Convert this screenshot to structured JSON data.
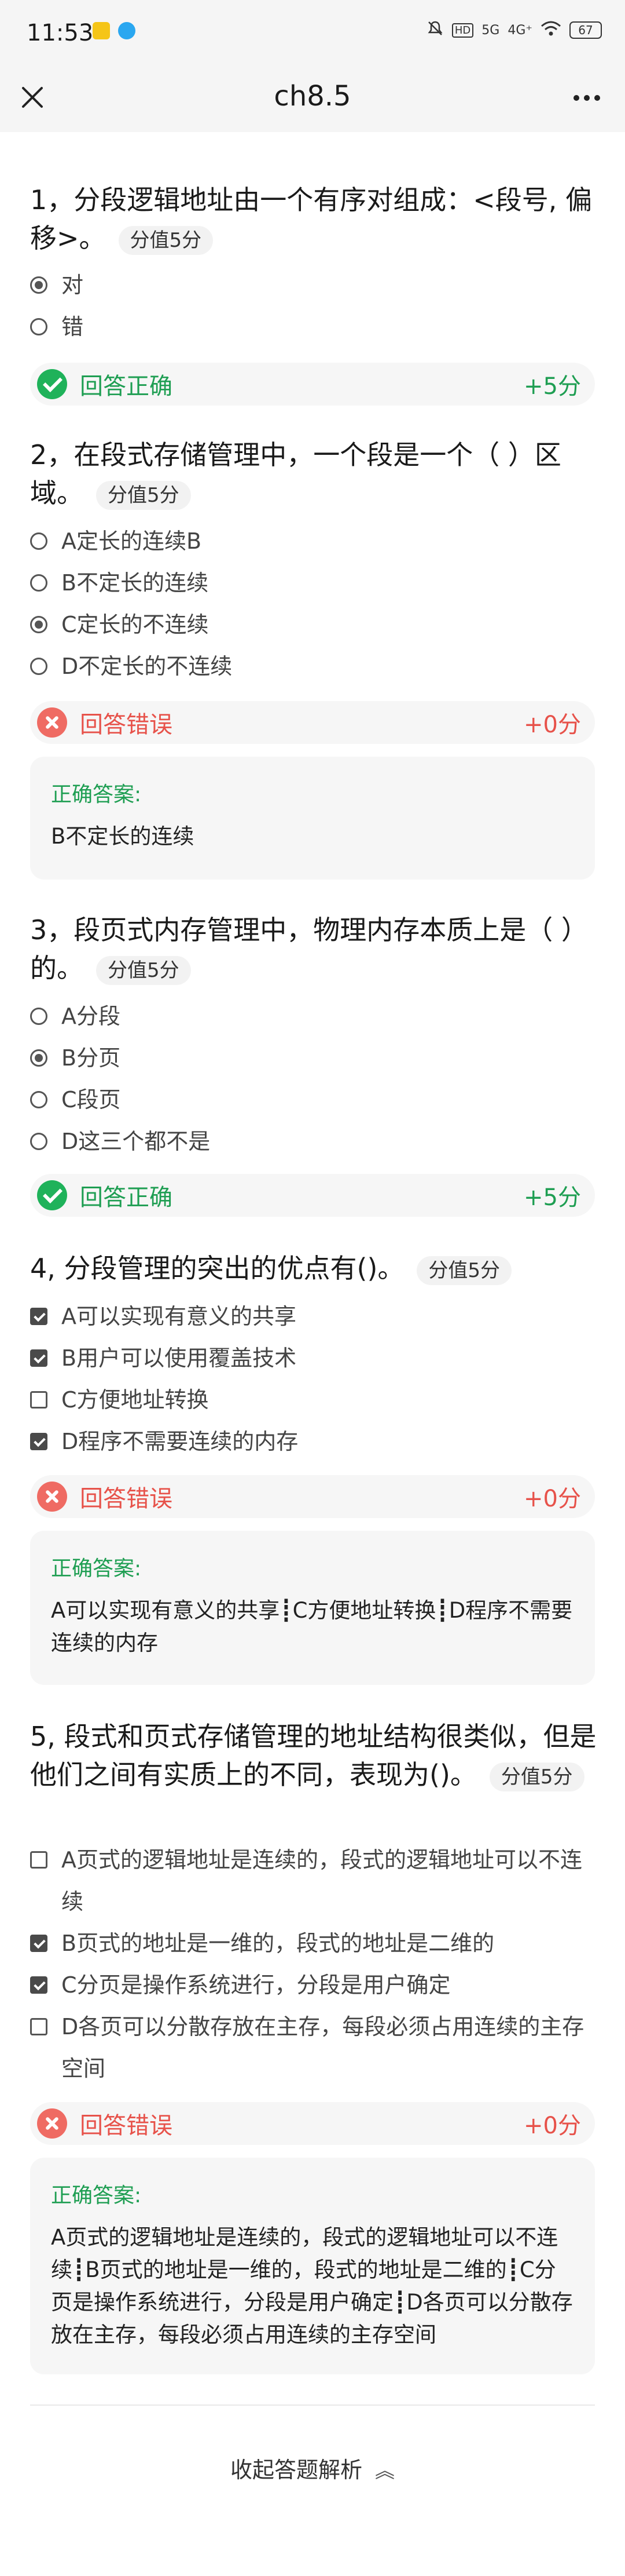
{
  "status_bar": {
    "time": "11:53",
    "network": "5G",
    "network2": "4G⁺",
    "battery": "67",
    "hd": "HD"
  },
  "header": {
    "title": "ch8.5"
  },
  "labels": {
    "correct_answer": "正确答案:"
  },
  "questions": [
    {
      "title": "1，分段逻辑地址由一个有序对组成：<段号, 偏移>。",
      "score": "分值5分",
      "options": [
        "对",
        "错"
      ],
      "result": {
        "text": "回答正确",
        "score": "+5分"
      }
    },
    {
      "title": "2，在段式存储管理中，一个段是一个（ ）区域。",
      "score": "分值5分",
      "options": [
        "A定长的连续B",
        "B不定长的连续",
        "C定长的不连续",
        "D不定长的不连续"
      ],
      "result": {
        "text": "回答错误",
        "score": "+0分"
      },
      "answer": "B不定长的连续"
    },
    {
      "title": "3，段页式内存管理中，物理内存本质上是（ ）的。",
      "score": "分值5分",
      "options": [
        "A分段",
        "B分页",
        "C段页",
        "D这三个都不是"
      ],
      "result": {
        "text": "回答正确",
        "score": "+5分"
      }
    },
    {
      "title": "4, 分段管理的突出的优点有()。",
      "score": "分值5分",
      "options": [
        "A可以实现有意义的共享",
        "B用户可以使用覆盖技术",
        "C方便地址转换",
        "D程序不需要连续的内存"
      ],
      "result": {
        "text": "回答错误",
        "score": "+0分"
      },
      "answer": "A可以实现有意义的共享┋C方便地址转换┋D程序不需要连续的内存"
    },
    {
      "title": "5, 段式和页式存储管理的地址结构很类似，但是他们之间有实质上的不同，表现为()。",
      "score": "分值5分",
      "options": [
        "A页式的逻辑地址是连续的，段式的逻辑地址可以不连续",
        "B页式的地址是一维的，段式的地址是二维的",
        "C分页是操作系统进行，分段是用户确定",
        "D各页可以分散存放在主存，每段必须占用连续的主存空间"
      ],
      "result": {
        "text": "回答错误",
        "score": "+0分"
      },
      "answer": "A页式的逻辑地址是连续的，段式的逻辑地址可以不连续┋B页式的地址是一维的，段式的地址是二维的┋C分页是操作系统进行，分段是用户确定┋D各页可以分散存放在主存，每段必须占用连续的主存空间"
    }
  ],
  "footer": {
    "collapse_label": "收起答题解析"
  }
}
